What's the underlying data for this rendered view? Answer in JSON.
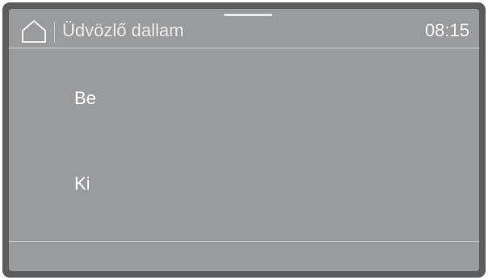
{
  "header": {
    "home_icon": "home-icon",
    "title": "Üdvözlő dallam",
    "time": "08:15"
  },
  "options": [
    {
      "label": "Be"
    },
    {
      "label": "Ki"
    }
  ],
  "colors": {
    "bezel": "#5b5c5e",
    "screen": "#9a9b9d",
    "text": "#ffffff",
    "divider": "#d6d6d6"
  }
}
